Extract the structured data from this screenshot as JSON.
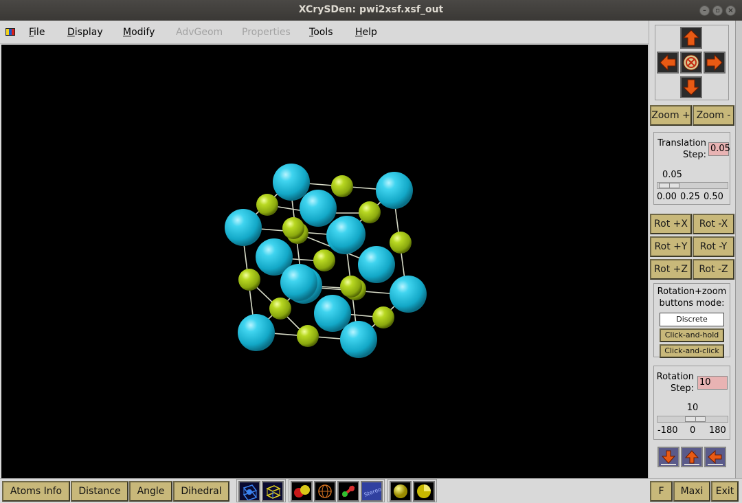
{
  "window": {
    "title": "XCrySDen: pwi2xsf.xsf_out",
    "controls": [
      "minimize",
      "maximize",
      "close"
    ]
  },
  "menubar": {
    "items": [
      {
        "label": "File",
        "underline": "F",
        "rest": "ile",
        "enabled": true
      },
      {
        "label": "Display",
        "underline": "D",
        "rest": "isplay",
        "enabled": true
      },
      {
        "label": "Modify",
        "underline": "M",
        "rest": "odify",
        "enabled": true
      },
      {
        "label": "AdvGeom",
        "underline": "",
        "rest": "AdvGeom",
        "enabled": false
      },
      {
        "label": "Properties",
        "underline": "",
        "rest": "Properties",
        "enabled": false
      },
      {
        "label": "Tools",
        "underline": "T",
        "rest": "ools",
        "enabled": true
      },
      {
        "label": "Help",
        "underline": "H",
        "rest": "elp",
        "enabled": true
      }
    ]
  },
  "panel": {
    "zoom_in": "Zoom +",
    "zoom_out": "Zoom -",
    "translation_label_1": "Translation",
    "translation_label_2": "Step:",
    "translation_value": "0.05",
    "translation_slider_value": "0.05",
    "translation_ticks": [
      "0.00",
      "0.25",
      "0.50"
    ],
    "rot_buttons": [
      "Rot +X",
      "Rot -X",
      "Rot +Y",
      "Rot -Y",
      "Rot +Z",
      "Rot -Z"
    ],
    "mode_label_1": "Rotation+zoom",
    "mode_label_2": "buttons mode:",
    "mode_discrete": "Discrete",
    "mode_click_hold": "Click-and-hold",
    "mode_click_click": "Click-and-click",
    "rotation_label_1": "Rotation",
    "rotation_label_2": "Step:",
    "rotation_value": "10",
    "rotation_slider_value": "10",
    "rotation_ticks": [
      "-180",
      "0",
      "180"
    ]
  },
  "bottom": {
    "atoms_info": "Atoms Info",
    "distance": "Distance",
    "angle": "Angle",
    "dihedral": "Dihedral",
    "f": "F",
    "maxi": "Maxi",
    "exit": "Exit"
  },
  "colors": {
    "large_atom": "#1ec0dc",
    "small_atom": "#a6c81a",
    "button": "#c8b87a",
    "entry_bg": "#e8b3b3"
  }
}
